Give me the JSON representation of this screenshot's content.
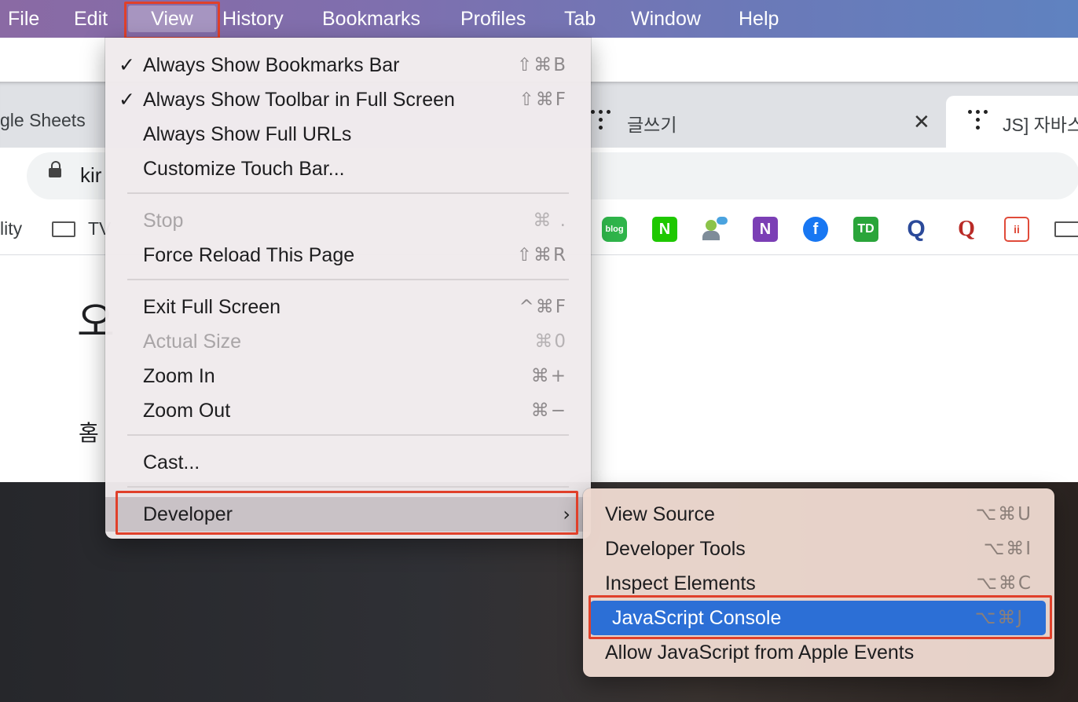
{
  "menubar": {
    "items": [
      "File",
      "Edit",
      "View",
      "History",
      "Bookmarks",
      "Profiles",
      "Tab",
      "Window",
      "Help"
    ],
    "active": "View"
  },
  "browser": {
    "tabs": [
      {
        "title": "gle Sheets"
      },
      {
        "title": "글쓰기",
        "close": "✕"
      },
      {
        "title": "JS] 자바스"
      }
    ],
    "omnibox_text": "kir",
    "bookmarks_partial": [
      "lity",
      "TV"
    ],
    "bookmark_icons": [
      "blog-icon",
      "naver-icon",
      "people-icon",
      "onenote-icon",
      "facebook-icon",
      "td-icon",
      "q-icon",
      "quora-icon",
      "chat-icon",
      "folder-icon"
    ],
    "page_chars": [
      "오",
      "홈"
    ]
  },
  "view_menu": {
    "items": [
      {
        "label": "Always Show Bookmarks Bar",
        "shortcut": "⇧⌘B",
        "checked": true
      },
      {
        "label": "Always Show Toolbar in Full Screen",
        "shortcut": "⇧⌘F",
        "checked": true
      },
      {
        "label": "Always Show Full URLs",
        "shortcut": ""
      },
      {
        "label": "Customize Touch Bar...",
        "shortcut": ""
      },
      {
        "label": "Stop",
        "shortcut": "⌘ .",
        "disabled": true
      },
      {
        "label": "Force Reload This Page",
        "shortcut": "⇧⌘R"
      },
      {
        "label": "Exit Full Screen",
        "shortcut": "^⌘F"
      },
      {
        "label": "Actual Size",
        "shortcut": "⌘0",
        "disabled": true
      },
      {
        "label": "Zoom In",
        "shortcut": "⌘+"
      },
      {
        "label": "Zoom Out",
        "shortcut": "⌘−"
      },
      {
        "label": "Cast...",
        "shortcut": ""
      },
      {
        "label": "Developer",
        "submenu": true
      }
    ],
    "check_glyph": "✓",
    "chevron": "›"
  },
  "developer_menu": {
    "items": [
      {
        "label": "View Source",
        "shortcut": "⌥⌘U"
      },
      {
        "label": "Developer Tools",
        "shortcut": "⌥⌘I"
      },
      {
        "label": "Inspect Elements",
        "shortcut": "⌥⌘C"
      },
      {
        "label": "JavaScript Console",
        "shortcut": "⌥⌘J",
        "selected": true
      },
      {
        "label": "Allow JavaScript from Apple Events",
        "shortcut": ""
      }
    ]
  },
  "colors": {
    "highlight_box": "#e0402a",
    "selection": "#2c6fd6"
  }
}
